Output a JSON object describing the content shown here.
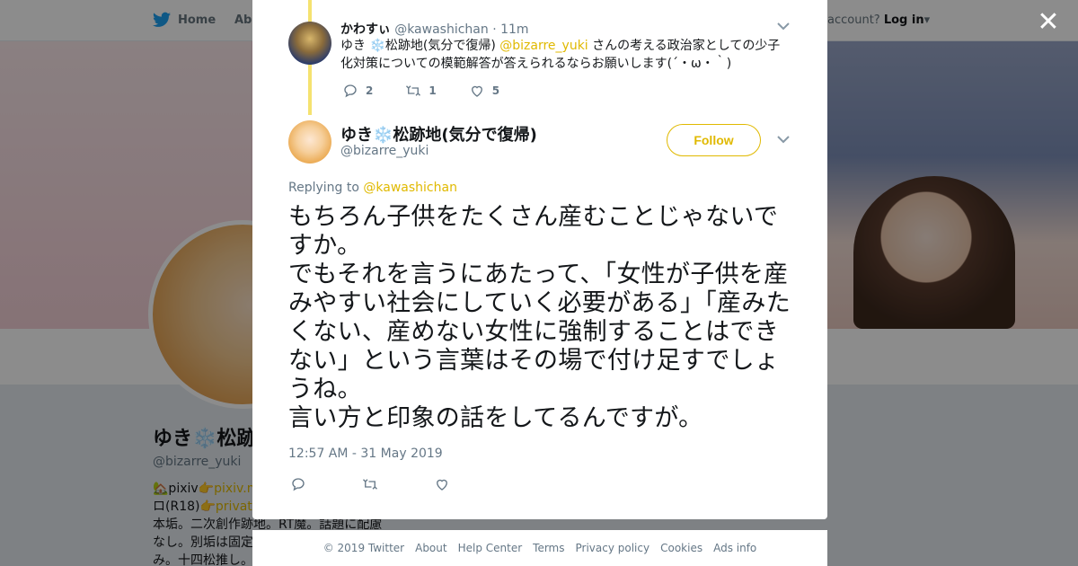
{
  "topnav": {
    "home_label": "Home",
    "about_label": "Abo",
    "account_prompt": "account?",
    "login_label": "Log in"
  },
  "profile": {
    "name": "ゆき❄️松跡",
    "handle": "@bizarre_yuki",
    "bio_line1_prefix": "🏡pixiv👉",
    "bio_line1_link": "pixiv.m",
    "bio_line2_prefix": "ロ(R18)👉",
    "bio_line2_link": "privatte",
    "bio_line3": "本垢。二次創作跡地。RT魔。話題に配慮",
    "bio_line4": "なし。別垢は固定",
    "bio_line5": "み。十四松推し。"
  },
  "parent_tweet": {
    "name": "かわすぃ",
    "handle": "@kawashichan",
    "time": "· 11m",
    "text_prefix": "ゆき ❄️松跡地(気分で復帰) ",
    "text_mention": "@bizarre_yuki",
    "text_suffix": " さんの考える政治家としての少子化対策についての模範解答が答えられるならお願いします(´・ω・｀)",
    "reply_count": "2",
    "retweet_count": "1",
    "like_count": "5"
  },
  "main_tweet": {
    "name": "ゆき❄️松跡地(気分で復帰)",
    "handle": "@bizarre_yuki",
    "follow_label": "Follow",
    "replying_label": "Replying to",
    "replying_mention": "@kawashichan",
    "text_lines": [
      "もちろん子供をたくさん産むことじゃないですか。",
      "でもそれを言うにあたって、「女性が子供を産みやすい社会にしていく必要がある」「産みたくない、産めない女性に強制することはできない」という言葉はその場で付け足すでしょうね。",
      "言い方と印象の話をしてるんですが。"
    ],
    "timestamp": "12:57 AM - 31 May 2019"
  },
  "footer": {
    "copyright": "© 2019 Twitter",
    "about": "About",
    "help": "Help Center",
    "terms": "Terms",
    "privacy": "Privacy policy",
    "cookies": "Cookies",
    "ads": "Ads info"
  },
  "icons": {
    "close": "close-icon",
    "chevron": "chevron-down-icon",
    "reply": "reply-icon",
    "retweet": "retweet-icon",
    "like": "heart-icon",
    "bird": "twitter-bird-icon"
  },
  "colors": {
    "accent": "#e0b900",
    "thread_line": "#f5e270",
    "muted": "#657786"
  }
}
